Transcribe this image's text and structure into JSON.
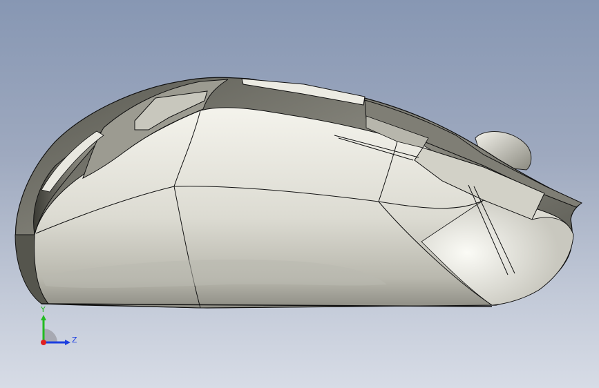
{
  "viewport": {
    "background_top": "#8797b3",
    "background_bottom": "#d7dce6"
  },
  "model": {
    "object": "computer-mouse",
    "view": "side",
    "body_color": "#d8d8d0",
    "edge_color": "#000000"
  },
  "triad": {
    "y_label": "Y",
    "z_label": "Z",
    "y_color": "#22bb22",
    "z_color": "#1c3fe0",
    "x_color": "#e02020"
  }
}
